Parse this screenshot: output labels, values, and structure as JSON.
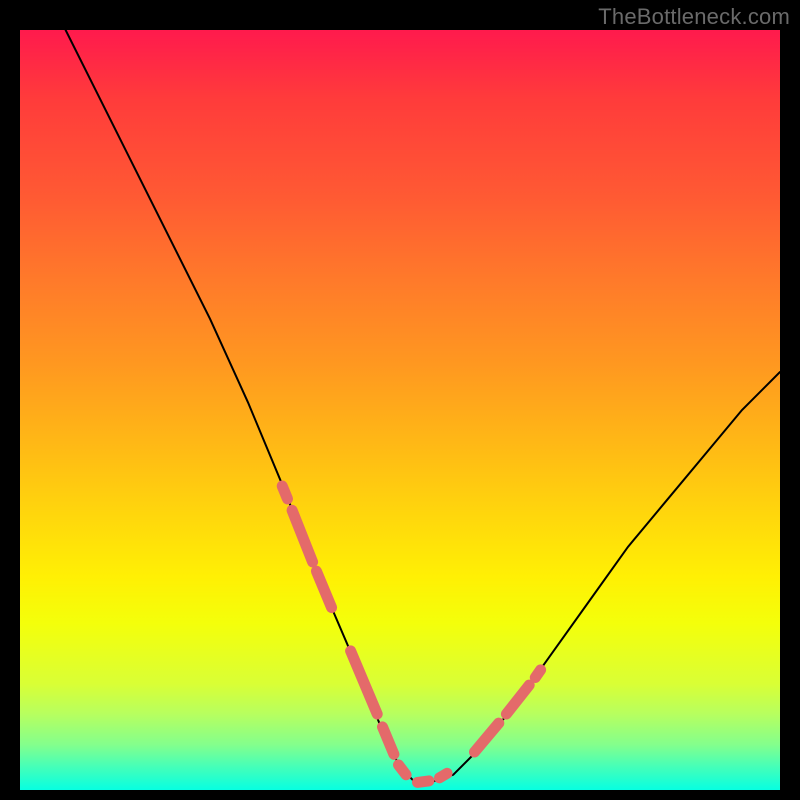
{
  "watermark": "TheBottleneck.com",
  "chart_data": {
    "type": "line",
    "title": "",
    "xlabel": "",
    "ylabel": "",
    "xlim": [
      0,
      100
    ],
    "ylim": [
      0,
      100
    ],
    "grid": false,
    "legend": "none",
    "series": [
      {
        "name": "curve",
        "x": [
          6,
          10,
          15,
          20,
          25,
          30,
          35,
          38,
          41,
          44,
          46,
          48,
          50,
          52,
          54,
          57,
          60,
          65,
          70,
          75,
          80,
          85,
          90,
          95,
          100
        ],
        "y": [
          100,
          92,
          82,
          72,
          62,
          51,
          39,
          31,
          24,
          17,
          12,
          7,
          3,
          1,
          1,
          2,
          5,
          11,
          18,
          25,
          32,
          38,
          44,
          50,
          55
        ]
      }
    ],
    "highlight_segments": [
      {
        "x": [
          34.5,
          35.2
        ],
        "y": [
          40.0,
          38.3
        ]
      },
      {
        "x": [
          35.8,
          38.5
        ],
        "y": [
          36.8,
          30.0
        ]
      },
      {
        "x": [
          39.0,
          41.0
        ],
        "y": [
          28.8,
          24.0
        ]
      },
      {
        "x": [
          43.5,
          47.0
        ],
        "y": [
          18.3,
          10.0
        ]
      },
      {
        "x": [
          47.7,
          49.2
        ],
        "y": [
          8.3,
          4.7
        ]
      },
      {
        "x": [
          49.8,
          50.8
        ],
        "y": [
          3.3,
          2.0
        ]
      },
      {
        "x": [
          52.3,
          53.8
        ],
        "y": [
          1.0,
          1.2
        ]
      },
      {
        "x": [
          55.2,
          56.2
        ],
        "y": [
          1.6,
          2.2
        ]
      },
      {
        "x": [
          59.8,
          63.0
        ],
        "y": [
          5.0,
          8.8
        ]
      },
      {
        "x": [
          64.0,
          67.0
        ],
        "y": [
          10.0,
          13.8
        ]
      },
      {
        "x": [
          67.8,
          68.5
        ],
        "y": [
          14.8,
          15.8
        ]
      }
    ],
    "gradient_stops": [
      {
        "pct": 0,
        "color": "#ff1a4d"
      },
      {
        "pct": 36,
        "color": "#ff7a2a"
      },
      {
        "pct": 72,
        "color": "#fff004"
      },
      {
        "pct": 100,
        "color": "#07ffe1"
      }
    ]
  }
}
